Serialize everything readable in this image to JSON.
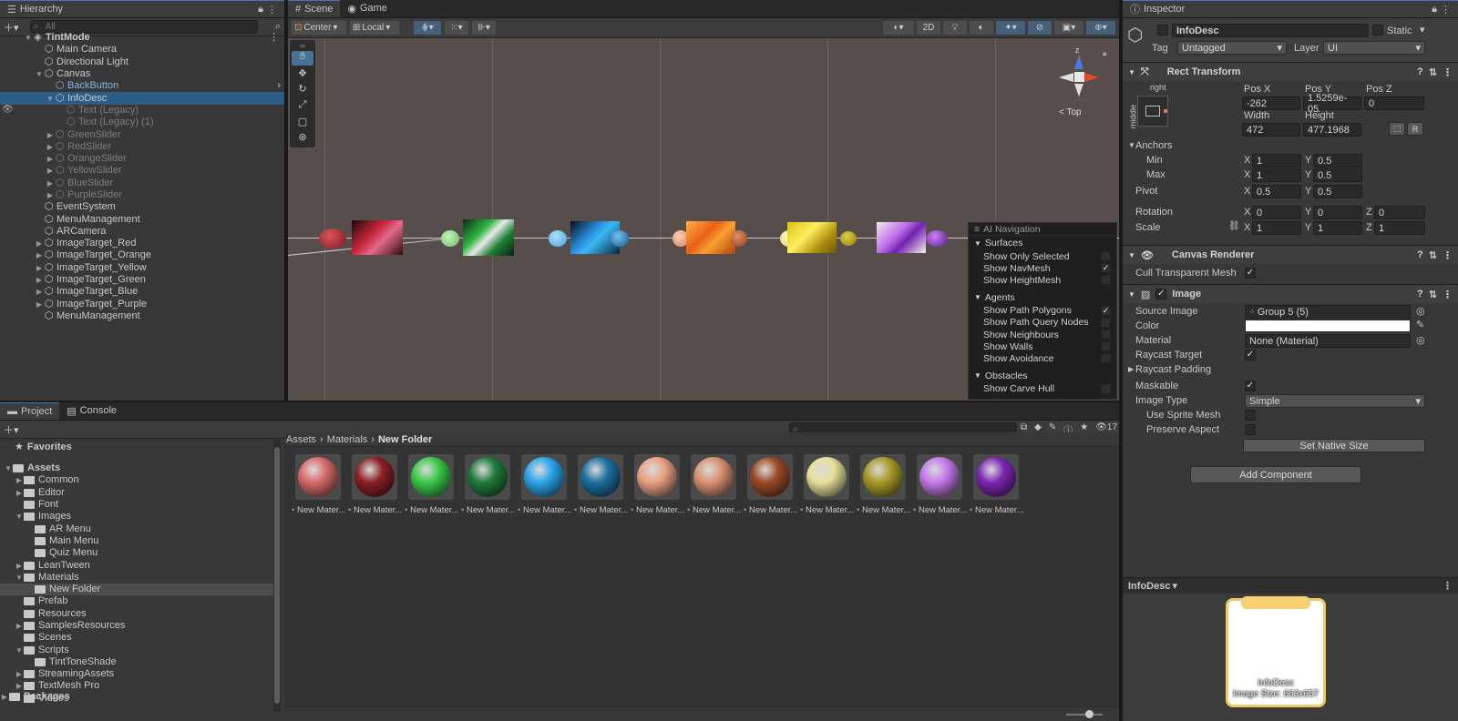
{
  "hierarchy": {
    "tab_label": "Hierarchy",
    "search_placeholder": "All",
    "rows": [
      {
        "label": "TintMode",
        "indent": 0,
        "arrow": "▼",
        "icon": "unity-scene-icon",
        "bold": true,
        "style": ""
      },
      {
        "label": "Main Camera",
        "indent": 1,
        "arrow": "",
        "icon": "cube-icon",
        "style": ""
      },
      {
        "label": "Directional Light",
        "indent": 1,
        "arrow": "",
        "icon": "cube-icon",
        "style": ""
      },
      {
        "label": "Canvas",
        "indent": 1,
        "arrow": "▼",
        "icon": "cube-icon",
        "style": ""
      },
      {
        "label": "BackButton",
        "indent": 2,
        "arrow": "",
        "icon": "cube-icon",
        "style": "blue",
        "more": true
      },
      {
        "label": "InfoDesc",
        "indent": 2,
        "arrow": "▼",
        "icon": "cube-icon",
        "style": "sel"
      },
      {
        "label": "Text (Legacy)",
        "indent": 3,
        "arrow": "",
        "icon": "cube-icon",
        "style": "dim"
      },
      {
        "label": "Text (Legacy) (1)",
        "indent": 3,
        "arrow": "",
        "icon": "cube-icon",
        "style": "dim"
      },
      {
        "label": "GreenSlider",
        "indent": 2,
        "arrow": "▶",
        "icon": "cube-icon",
        "style": "dim"
      },
      {
        "label": "RedSlider",
        "indent": 2,
        "arrow": "▶",
        "icon": "cube-icon",
        "style": "dim"
      },
      {
        "label": "OrangeSlider",
        "indent": 2,
        "arrow": "▶",
        "icon": "cube-icon",
        "style": "dim"
      },
      {
        "label": "YellowSlider",
        "indent": 2,
        "arrow": "▶",
        "icon": "cube-icon",
        "style": "dim"
      },
      {
        "label": "BlueSlider",
        "indent": 2,
        "arrow": "▶",
        "icon": "cube-icon",
        "style": "dim"
      },
      {
        "label": "PurpleSlider",
        "indent": 2,
        "arrow": "▶",
        "icon": "cube-icon",
        "style": "dim"
      },
      {
        "label": "EventSystem",
        "indent": 1,
        "arrow": "",
        "icon": "cube-icon",
        "style": ""
      },
      {
        "label": "MenuManagement",
        "indent": 1,
        "arrow": "",
        "icon": "cube-icon",
        "style": ""
      },
      {
        "label": "ARCamera",
        "indent": 1,
        "arrow": "",
        "icon": "cube-icon",
        "style": ""
      },
      {
        "label": "ImageTarget_Red",
        "indent": 1,
        "arrow": "▶",
        "icon": "cube-icon",
        "style": ""
      },
      {
        "label": "ImageTarget_Orange",
        "indent": 1,
        "arrow": "▶",
        "icon": "cube-icon",
        "style": ""
      },
      {
        "label": "ImageTarget_Yellow",
        "indent": 1,
        "arrow": "▶",
        "icon": "cube-icon",
        "style": ""
      },
      {
        "label": "ImageTarget_Green",
        "indent": 1,
        "arrow": "▶",
        "icon": "cube-icon",
        "style": ""
      },
      {
        "label": "ImageTarget_Blue",
        "indent": 1,
        "arrow": "▶",
        "icon": "cube-icon",
        "style": ""
      },
      {
        "label": "ImageTarget_Purple",
        "indent": 1,
        "arrow": "▶",
        "icon": "cube-icon",
        "style": ""
      },
      {
        "label": "MenuManagement",
        "indent": 1,
        "arrow": "",
        "icon": "cube-icon",
        "style": ""
      }
    ]
  },
  "scene": {
    "tabs": [
      "Scene",
      "Game"
    ],
    "toolbar": {
      "pivot": "Center",
      "space": "Local",
      "mode_2d": "2D"
    },
    "gizmo": {
      "axis_z": "z",
      "view_label": "Top"
    },
    "ai_nav": {
      "title": "AI Navigation",
      "groups": [
        {
          "name": "Surfaces",
          "items": [
            {
              "label": "Show Only Selected",
              "checked": false
            },
            {
              "label": "Show NavMesh",
              "checked": true
            },
            {
              "label": "Show HeightMesh",
              "checked": false
            }
          ]
        },
        {
          "name": "Agents",
          "items": [
            {
              "label": "Show Path Polygons",
              "checked": true
            },
            {
              "label": "Show Path Query Nodes",
              "checked": false
            },
            {
              "label": "Show Neighbours",
              "checked": false
            },
            {
              "label": "Show Walls",
              "checked": false
            },
            {
              "label": "Show Avoidance",
              "checked": false
            }
          ]
        },
        {
          "name": "Obstacles",
          "items": [
            {
              "label": "Show Carve Hull",
              "checked": false
            }
          ]
        }
      ]
    }
  },
  "project": {
    "tabs": [
      "Project",
      "Console"
    ],
    "count": "17",
    "favorites_label": "Favorites",
    "tree": [
      {
        "label": "Assets",
        "indent": 0,
        "arrow": "▼",
        "bold": true,
        "sel": false
      },
      {
        "label": "Common",
        "indent": 1,
        "arrow": "▶",
        "sel": false
      },
      {
        "label": "Editor",
        "indent": 1,
        "arrow": "▶",
        "sel": false
      },
      {
        "label": "Font",
        "indent": 1,
        "arrow": "",
        "sel": false
      },
      {
        "label": "Images",
        "indent": 1,
        "arrow": "▼",
        "sel": false
      },
      {
        "label": "AR Menu",
        "indent": 2,
        "arrow": "",
        "sel": false
      },
      {
        "label": "Main Menu",
        "indent": 2,
        "arrow": "",
        "sel": false
      },
      {
        "label": "Quiz Menu",
        "indent": 2,
        "arrow": "",
        "sel": false
      },
      {
        "label": "LeanTween",
        "indent": 1,
        "arrow": "▶",
        "sel": false
      },
      {
        "label": "Materials",
        "indent": 1,
        "arrow": "▼",
        "sel": false
      },
      {
        "label": "New Folder",
        "indent": 2,
        "arrow": "",
        "sel": true
      },
      {
        "label": "Prefab",
        "indent": 1,
        "arrow": "",
        "sel": false
      },
      {
        "label": "Resources",
        "indent": 1,
        "arrow": "",
        "sel": false
      },
      {
        "label": "SamplesResources",
        "indent": 1,
        "arrow": "▶",
        "sel": false
      },
      {
        "label": "Scenes",
        "indent": 1,
        "arrow": "",
        "sel": false
      },
      {
        "label": "Scripts",
        "indent": 1,
        "arrow": "▼",
        "sel": false
      },
      {
        "label": "TintToneShade",
        "indent": 2,
        "arrow": "",
        "sel": false
      },
      {
        "label": "StreamingAssets",
        "indent": 1,
        "arrow": "▶",
        "sel": false
      },
      {
        "label": "TextMesh Pro",
        "indent": 1,
        "arrow": "▶",
        "sel": false
      },
      {
        "label": "Videos",
        "indent": 1,
        "arrow": "",
        "sel": false
      }
    ],
    "packages_label": "Packages",
    "breadcrumb": [
      "Assets",
      "Materials",
      "New Folder"
    ],
    "assets": [
      {
        "label": "New Mater...",
        "color": "#d86a6a"
      },
      {
        "label": "New Mater...",
        "color": "#8c1f26"
      },
      {
        "label": "New Mater...",
        "color": "#3cc84a"
      },
      {
        "label": "New Mater...",
        "color": "#1f7a38"
      },
      {
        "label": "New Mater...",
        "color": "#2aa5e8"
      },
      {
        "label": "New Mater...",
        "color": "#1c6ea0"
      },
      {
        "label": "New Mater...",
        "color": "#e8a184"
      },
      {
        "label": "New Mater...",
        "color": "#d99272"
      },
      {
        "label": "New Mater...",
        "color": "#9a4a25"
      },
      {
        "label": "New Mater...",
        "color": "#e8e19a"
      },
      {
        "label": "New Mater...",
        "color": "#a89a28"
      },
      {
        "label": "New Mater...",
        "color": "#c27ae8"
      },
      {
        "label": "New Mater...",
        "color": "#7a27b0"
      }
    ]
  },
  "inspector": {
    "tab_label": "Inspector",
    "object_name": "InfoDesc",
    "static_label": "Static",
    "tag_label": "Tag",
    "tag_value": "Untagged",
    "layer_label": "Layer",
    "layer_value": "UI",
    "rect_transform": {
      "title": "Rect Transform",
      "anchor_h": "right",
      "anchor_v": "middle",
      "pos_x_label": "Pos X",
      "pos_x": "-262",
      "pos_y_label": "Pos Y",
      "pos_y": "1.5259e-05",
      "pos_z_label": "Pos Z",
      "pos_z": "0",
      "width_label": "Width",
      "width": "472",
      "height_label": "Height",
      "height": "477.1968",
      "r_btn": "R",
      "anchors_label": "Anchors",
      "min_label": "Min",
      "min_x": "1",
      "min_y": "0.5",
      "max_label": "Max",
      "max_x": "1",
      "max_y": "0.5",
      "pivot_label": "Pivot",
      "pivot_x": "0.5",
      "pivot_y": "0.5",
      "rotation_label": "Rotation",
      "rot_x": "0",
      "rot_y": "0",
      "rot_z": "0",
      "scale_label": "Scale",
      "scale_x": "1",
      "scale_y": "1",
      "scale_z": "1",
      "x": "X",
      "y": "Y",
      "z": "Z"
    },
    "canvas_renderer": {
      "title": "Canvas Renderer",
      "cull_label": "Cull Transparent Mesh",
      "cull_checked": true
    },
    "image": {
      "title": "Image",
      "source_label": "Source Image",
      "source_value": "Group 5 (5)",
      "color_label": "Color",
      "color_value": "#ffffff",
      "material_label": "Material",
      "material_value": "None (Material)",
      "raycast_label": "Raycast Target",
      "padding_label": "Raycast Padding",
      "maskable_label": "Maskable",
      "type_label": "Image Type",
      "type_value": "Simple",
      "sprite_mesh_label": "Use Sprite Mesh",
      "aspect_label": "Preserve Aspect",
      "native_btn": "Set Native Size"
    },
    "add_component": "Add Component",
    "preview": {
      "title": "InfoDesc",
      "caption1": "InfoDesc",
      "caption2": "Image Size: 663x657"
    }
  }
}
